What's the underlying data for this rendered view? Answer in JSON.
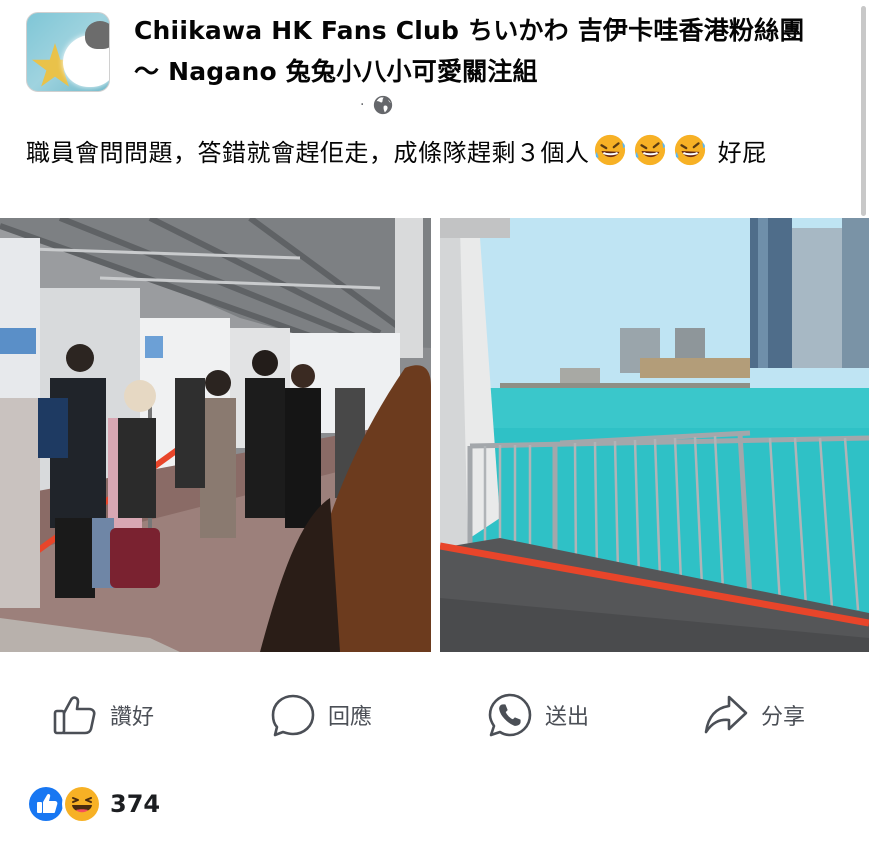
{
  "post": {
    "page_name": "Chiikawa HK Fans Club ちいかわ 吉伊卡哇香港粉絲團～ Nagano 兔兔小八小可愛關注組",
    "meta_dot": "·",
    "audience_icon": "globe-icon",
    "text_before_emoji": "職員會問問題，答錯就會趕佢走，成條隊趕剩３個人",
    "emoji": [
      "rolling-on-floor-laughing",
      "rolling-on-floor-laughing",
      "rolling-on-floor-laughing"
    ],
    "text_after_emoji": " 好屁"
  },
  "photos": [
    {
      "name": "queue-walkway-photo"
    },
    {
      "name": "harbour-railing-photo"
    }
  ],
  "actions": {
    "like": {
      "label": "讚好",
      "icon": "thumbs-up-icon"
    },
    "comment": {
      "label": "回應",
      "icon": "speech-bubble-icon"
    },
    "send": {
      "label": "送出",
      "icon": "whatsapp-icon"
    },
    "share": {
      "label": "分享",
      "icon": "share-arrow-icon"
    }
  },
  "reactions": {
    "icons": [
      "like-reaction-icon",
      "haha-reaction-icon"
    ],
    "count": "374"
  },
  "colors": {
    "like_blue": "#1877f2",
    "haha_yellow": "#f7b125",
    "action_gray": "#4b4f56",
    "meta_gray": "#65676b",
    "sea_teal": "#2fc1c6",
    "sky_blue": "#bfe4f3",
    "barrier_red": "#e8452a"
  }
}
